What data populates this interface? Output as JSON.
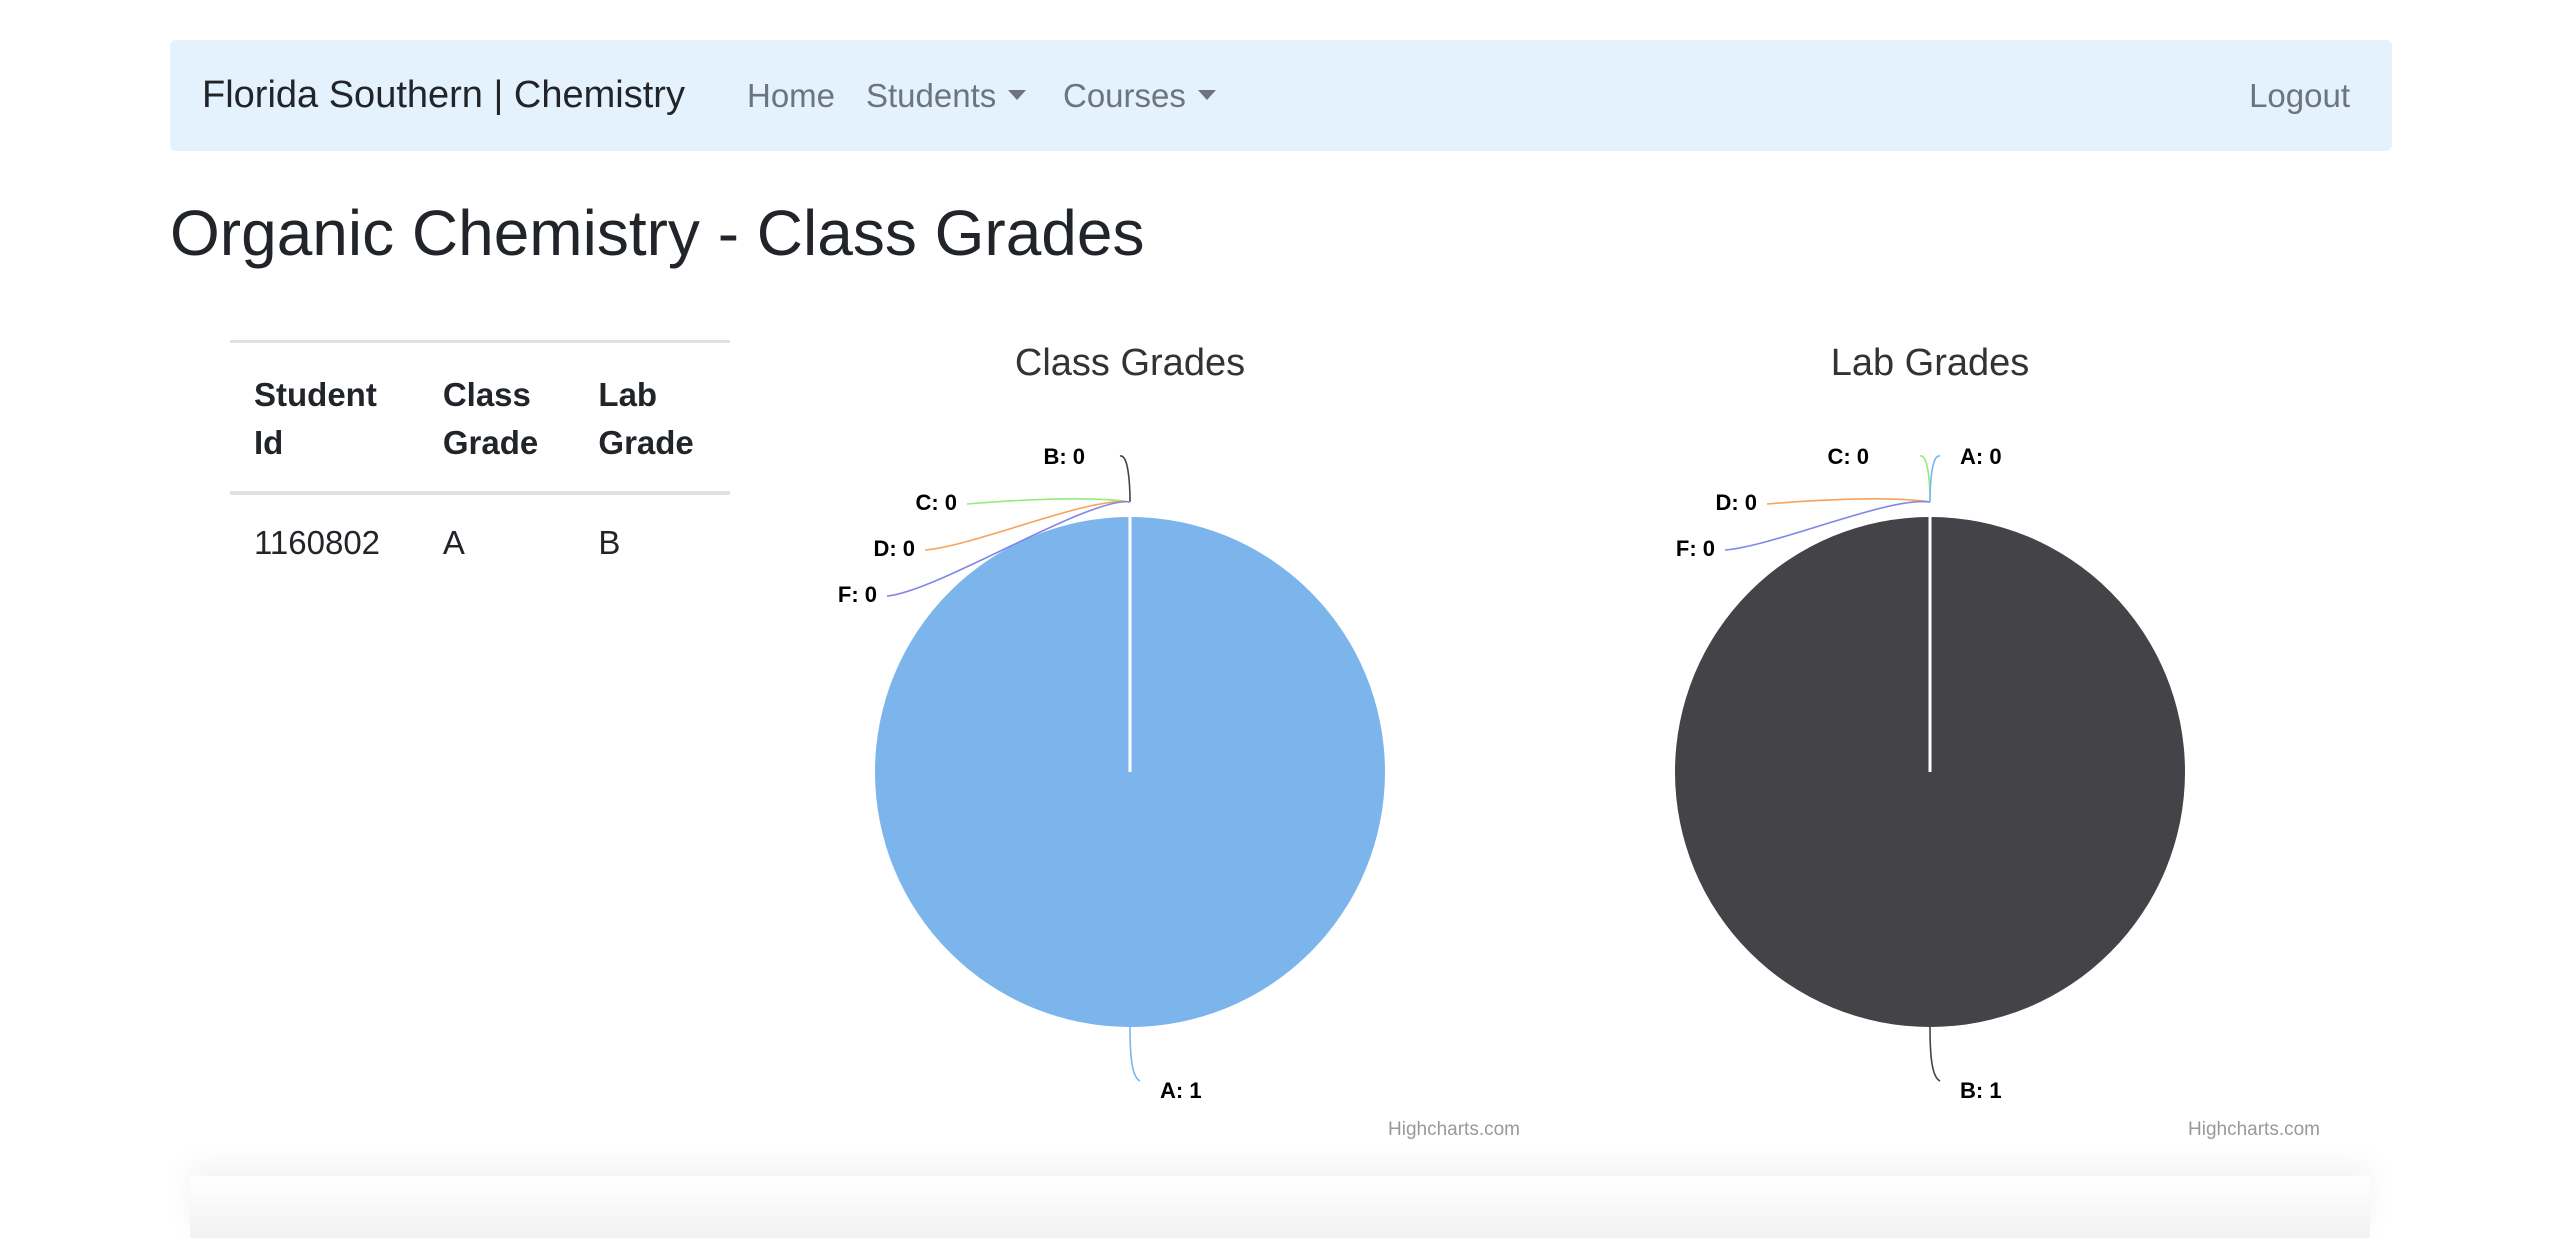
{
  "navbar": {
    "brand": "Florida Southern | Chemistry",
    "items": [
      {
        "label": "Home",
        "dropdown": false
      },
      {
        "label": "Students",
        "dropdown": true
      },
      {
        "label": "Courses",
        "dropdown": true
      }
    ],
    "logout": "Logout"
  },
  "page": {
    "title": "Organic Chemistry - Class Grades"
  },
  "table": {
    "headers": [
      {
        "line1": "Student",
        "line2": "Id"
      },
      {
        "line1": "Class",
        "line2": "Grade"
      },
      {
        "line1": "Lab",
        "line2": "Grade"
      }
    ],
    "rows": [
      [
        "1160802",
        "A",
        "B"
      ]
    ]
  },
  "chart_data": [
    {
      "type": "pie",
      "title": "Class Grades",
      "credits": "Highcharts.com",
      "slices": [
        {
          "name": "A",
          "value": 1,
          "color": "#7cb5ec",
          "label": "A: 1"
        },
        {
          "name": "B",
          "value": 0,
          "color": "#434348",
          "label": "B: 0"
        },
        {
          "name": "C",
          "value": 0,
          "color": "#90ed7d",
          "label": "C: 0"
        },
        {
          "name": "D",
          "value": 0,
          "color": "#f7a35c",
          "label": "D: 0"
        },
        {
          "name": "F",
          "value": 0,
          "color": "#8085e9",
          "label": "F: 0"
        }
      ]
    },
    {
      "type": "pie",
      "title": "Lab Grades",
      "credits": "Highcharts.com",
      "slices": [
        {
          "name": "A",
          "value": 0,
          "color": "#7cb5ec",
          "label": "A: 0"
        },
        {
          "name": "B",
          "value": 1,
          "color": "#434348",
          "label": "B: 1"
        },
        {
          "name": "C",
          "value": 0,
          "color": "#90ed7d",
          "label": "C: 0"
        },
        {
          "name": "D",
          "value": 0,
          "color": "#f7a35c",
          "label": "D: 0"
        },
        {
          "name": "F",
          "value": 0,
          "color": "#8085e9",
          "label": "F: 0"
        }
      ]
    }
  ]
}
